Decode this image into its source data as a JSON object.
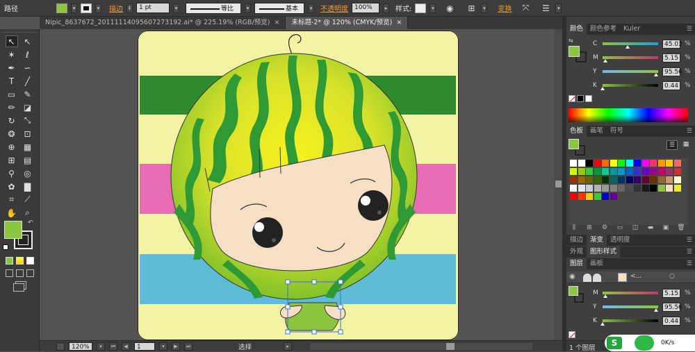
{
  "control_bar": {
    "object_type": "路径",
    "fill_color": "#8cc63f",
    "stroke_label": "描边",
    "stroke_weight": "1 pt",
    "profile_label": "等比",
    "brush_label": "基本",
    "opacity_label": "不透明度",
    "opacity_value": "100%",
    "style_label": "样式",
    "transform_label": "变换"
  },
  "doc_tabs": [
    {
      "label": "Nipic_8637672_20111114095607273192.ai* @ 225.19% (RGB/预览)",
      "close": "×"
    },
    {
      "label": "未标题-2* @ 120% (CMYK/预览)",
      "close": "×"
    }
  ],
  "tools": [
    {
      "name": "selection-tool",
      "icon": "selection-icon",
      "glyph": "↖"
    },
    {
      "name": "direct-selection-tool",
      "icon": "direct-selection-icon",
      "glyph": "↖"
    },
    {
      "name": "magic-wand-tool",
      "icon": "magic-wand-icon",
      "glyph": "✶"
    },
    {
      "name": "lasso-tool",
      "icon": "lasso-icon",
      "glyph": "ℓ"
    },
    {
      "name": "pen-tool",
      "icon": "pen-icon",
      "glyph": "✒"
    },
    {
      "name": "curvature-tool",
      "icon": "curvature-icon",
      "glyph": "∽"
    },
    {
      "name": "type-tool",
      "icon": "type-icon",
      "glyph": "T"
    },
    {
      "name": "line-tool",
      "icon": "line-icon",
      "glyph": "╱"
    },
    {
      "name": "rectangle-tool",
      "icon": "rectangle-icon",
      "glyph": "▭"
    },
    {
      "name": "paintbrush-tool",
      "icon": "paintbrush-icon",
      "glyph": "✎"
    },
    {
      "name": "pencil-tool",
      "icon": "pencil-icon",
      "glyph": "✏"
    },
    {
      "name": "eraser-tool",
      "icon": "eraser-icon",
      "glyph": "◪"
    },
    {
      "name": "rotate-tool",
      "icon": "rotate-icon",
      "glyph": "↻"
    },
    {
      "name": "scale-tool",
      "icon": "scale-icon",
      "glyph": "⤡"
    },
    {
      "name": "warp-tool",
      "icon": "warp-icon",
      "glyph": "❂"
    },
    {
      "name": "free-transform-tool",
      "icon": "free-transform-icon",
      "glyph": "⊡"
    },
    {
      "name": "shape-builder-tool",
      "icon": "shape-builder-icon",
      "glyph": "⊕"
    },
    {
      "name": "perspective-grid-tool",
      "icon": "perspective-grid-icon",
      "glyph": "▦"
    },
    {
      "name": "mesh-tool",
      "icon": "mesh-icon",
      "glyph": "⊞"
    },
    {
      "name": "gradient-tool",
      "icon": "gradient-icon",
      "glyph": "▤"
    },
    {
      "name": "eyedropper-tool",
      "icon": "eyedropper-icon",
      "glyph": "⚲"
    },
    {
      "name": "blend-tool",
      "icon": "blend-icon",
      "glyph": "◎"
    },
    {
      "name": "symbol-sprayer-tool",
      "icon": "symbol-sprayer-icon",
      "glyph": "✿"
    },
    {
      "name": "column-graph-tool",
      "icon": "column-graph-icon",
      "glyph": "▇"
    },
    {
      "name": "artboard-tool",
      "icon": "artboard-icon",
      "glyph": "⌗"
    },
    {
      "name": "slice-tool",
      "icon": "slice-icon",
      "glyph": "⟋"
    },
    {
      "name": "hand-tool",
      "icon": "hand-icon",
      "glyph": "✋"
    },
    {
      "name": "zoom-tool",
      "icon": "zoom-icon",
      "glyph": "⌕"
    }
  ],
  "colors": {
    "fill": "#8cc63f",
    "stroke": "#000000",
    "stripe_green": "#2e8b2e",
    "stripe_cream": "#f5f5a0",
    "stripe_pink": "#e86cb4",
    "stripe_blue": "#5fbcd8",
    "artboard_bg": "#f3f3a4",
    "melon_light": "#e8ec2a",
    "melon_dark": "#2e9a35",
    "face": "#f5dfc5"
  },
  "status_bar": {
    "zoom": "120%",
    "artboard_number": "1",
    "tool_status": "选择"
  },
  "color_panel": {
    "tabs": [
      "颜色",
      "颜色参考",
      "Kuler"
    ],
    "channels": [
      {
        "label": "C",
        "value": "45.03",
        "fraction": 0.45,
        "gradient": "linear-gradient(90deg,#8cc63f,#1ea0d8)"
      },
      {
        "label": "M",
        "value": "5.15",
        "fraction": 0.05,
        "gradient": "linear-gradient(90deg,#8cc63f,#c8336a)"
      },
      {
        "label": "Y",
        "value": "95.56",
        "fraction": 0.96,
        "gradient": "linear-gradient(90deg,#7ab8e8,#8cc63f)"
      },
      {
        "label": "K",
        "value": "0.44",
        "fraction": 0.0,
        "gradient": "linear-gradient(90deg,#8cc63f,#000)"
      }
    ],
    "unit": "%"
  },
  "swatches_panel": {
    "tabs": [
      "色板",
      "画笔",
      "符号"
    ],
    "rows": [
      [
        "#ffffff",
        "#ffffff",
        "#000000",
        "#ff0000",
        "#ff6600",
        "#ffff00",
        "#00ff00",
        "#00ffff",
        "#0000ff",
        "#ff00ff",
        "#ff3366",
        "#ff9900",
        "#ffcc00",
        "#ff6666"
      ],
      [
        "#ccff00",
        "#99cc00",
        "#33cc33",
        "#009933",
        "#00cc99",
        "#009999",
        "#0099cc",
        "#0066cc",
        "#3333cc",
        "#6600cc",
        "#990099",
        "#cc0066",
        "#993366",
        "#cc3333"
      ],
      [
        "#993300",
        "#996600",
        "#666600",
        "#336600",
        "#003300",
        "#006666",
        "#003366",
        "#000066",
        "#330066",
        "#660033",
        "#663300",
        "#996633",
        "#cc9966",
        "#ffffcc"
      ],
      [
        "#ffffff",
        "#e6e6e6",
        "#cccccc",
        "#b3b3b3",
        "#999999",
        "#808080",
        "#666666",
        "#4d4d4d",
        "#333333",
        "#1a1a1a",
        "#000000",
        "#8cc63f",
        "#f5dfc5",
        "#e8ec2a"
      ],
      [
        "#ff0000",
        "#ff3300",
        "#ffcc00",
        "#33cc33",
        "#0000cc",
        "#660099"
      ]
    ]
  },
  "mid_tabs": [
    "描边",
    "渐变",
    "透明度"
  ],
  "appearance_tabs": [
    "外观",
    "图形样式"
  ],
  "layers_panel": {
    "tabs": [
      "图层",
      "画板"
    ],
    "row_name": "<...",
    "count_label": "1 个图层"
  },
  "color_panel_2": {
    "channels": [
      {
        "label": "M",
        "value": "5.15",
        "fraction": 0.05,
        "gradient": "linear-gradient(90deg,#8cc63f,#c8336a)"
      },
      {
        "label": "Y",
        "value": "95.56",
        "fraction": 0.96,
        "gradient": "linear-gradient(90deg,#7ab8e8,#8cc63f)"
      },
      {
        "label": "K",
        "value": "0.44",
        "fraction": 0.0,
        "gradient": "linear-gradient(90deg,#8cc63f,#000)"
      }
    ]
  },
  "network_widget": {
    "speed": "0K/s",
    "brand_glyph": "S"
  }
}
